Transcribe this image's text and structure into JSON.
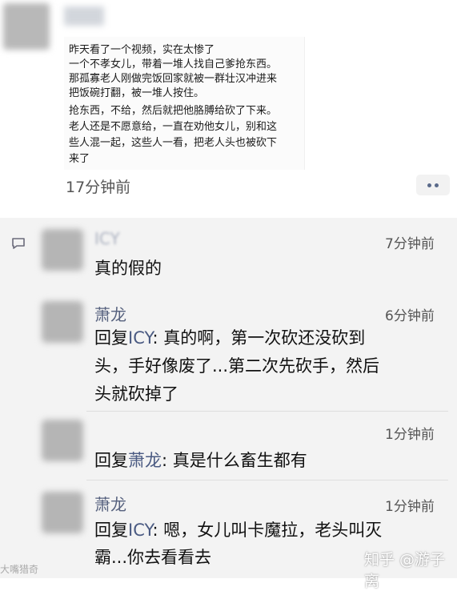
{
  "post": {
    "lines": [
      "昨天看了一个视频，实在太惨了",
      "一个不孝女儿，带着一堆人找自己爹抢东西。",
      "那孤寡老人刚做完饭回家就被一群壮汉冲进来",
      "把饭碗打翻，被一堆人按住。",
      "抢东西，不给，然后就把他胳膊给砍了下来。",
      "老人还是不愿意给，一直在劝他女儿，别和这",
      "些人混一起，这些人一看，把老人头也被砍下",
      "来了"
    ],
    "time": "17分钟前"
  },
  "comments": [
    {
      "name": "ICY",
      "time": "7分钟前",
      "text_lines": [
        "真的假的"
      ]
    },
    {
      "name": "萧龙",
      "time": "6分钟前",
      "reply_prefix": "回复",
      "reply_to": "ICY",
      "text_lines": [
        ": 真的啊，第一次砍还没砍到",
        "头，手好像废了...第二次先砍手，然后",
        "头就砍掉了"
      ]
    },
    {
      "name": "",
      "time": "1分钟前",
      "reply_prefix": "回复",
      "reply_to": "萧龙",
      "text_lines": [
        ": 真是什么畜生都有"
      ]
    },
    {
      "name": "萧龙",
      "time": "1分钟前",
      "reply_prefix": "回复",
      "reply_to": "ICY",
      "text_lines": [
        ": 嗯，女儿叫卡魔拉，老头叫灭",
        "霸...你去看看去"
      ]
    }
  ],
  "watermark": {
    "left": "大嘴猎奇",
    "right": "知乎 @游子离"
  },
  "colors": {
    "link_blue": "#57627f",
    "comments_bg": "#f3f3f3"
  },
  "icons": [
    "comment-icon",
    "more-icon"
  ]
}
